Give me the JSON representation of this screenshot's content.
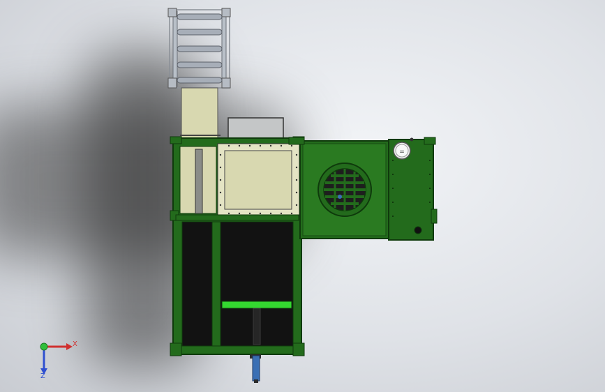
{
  "viewport": {
    "title": "",
    "view": "top-view-cad-model"
  },
  "triad": {
    "x_label": "X",
    "z_label": "Z",
    "x_color": "#d0302f",
    "y_color": "#2fbf3a",
    "z_color": "#2f4fd0"
  },
  "gauge": {
    "label": "="
  },
  "colors": {
    "frame_green": "#236b1c",
    "frame_dark": "#123c0f",
    "beige": "#d8d8b0",
    "beige_dark": "#a9a988",
    "cavity_black": "#121212",
    "bright_green": "#34d830",
    "steel_blue": "#3a6fb4"
  }
}
